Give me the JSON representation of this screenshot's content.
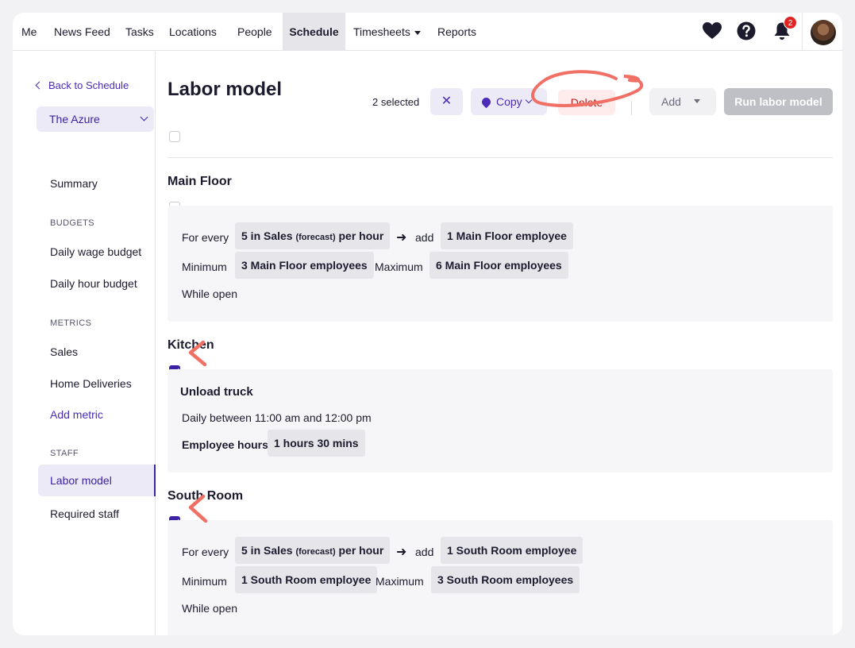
{
  "nav": {
    "items": [
      "Me",
      "News Feed",
      "Tasks",
      "Locations",
      "People",
      "Schedule",
      "Timesheets",
      "Reports"
    ],
    "active": "Schedule",
    "notification_count": "2",
    "icons": [
      "heart-icon",
      "help-icon",
      "bell-icon"
    ]
  },
  "sidebar": {
    "back_label": "Back to Schedule",
    "venue": "The Azure",
    "summary": "Summary",
    "budgets_header": "BUDGETS",
    "daily_wage_budget": "Daily wage budget",
    "daily_hour_budget": "Daily hour budget",
    "metrics_header": "METRICS",
    "sales": "Sales",
    "home_deliveries": "Home Deliveries",
    "add_metric": "Add metric",
    "staff_header": "STAFF",
    "labor_model": "Labor model",
    "required_staff": "Required staff"
  },
  "header": {
    "title": "Labor model",
    "selected": "2 selected",
    "close_label": "✕",
    "copy_label": "Copy",
    "delete_label": "Delete",
    "add_label": "Add",
    "run_label": "Run labor model"
  },
  "sections": {
    "main_floor": {
      "title": "Main Floor",
      "checked": false,
      "for_every": "For every",
      "rate_value": "5 in Sales",
      "rate_qualifier": "(forecast)",
      "rate_unit": "per hour",
      "add": "add",
      "add_value": "1 Main Floor employee",
      "minimum": "Minimum",
      "minimum_value": "3 Main Floor employees",
      "maximum": "Maximum",
      "maximum_value": "6 Main Floor employees",
      "while_open": "While open"
    },
    "kitchen": {
      "title": "Kitchen",
      "checked": true,
      "task_title": "Unload truck",
      "schedule": "Daily between 11:00 am and 12:00 pm",
      "hours_label": "Employee hours",
      "hours_value": "1 hours 30 mins"
    },
    "south_room": {
      "title": "South Room",
      "checked": true,
      "for_every": "For every",
      "rate_value": "5 in Sales",
      "rate_qualifier": "(forecast)",
      "rate_unit": "per hour",
      "add": "add",
      "add_value": "1 South Room employee",
      "minimum": "Minimum",
      "minimum_value": "1 South Room employee",
      "maximum": "Maximum",
      "maximum_value": "3 South Room employees",
      "while_open": "While open"
    }
  },
  "annotation_color": "#f07065"
}
